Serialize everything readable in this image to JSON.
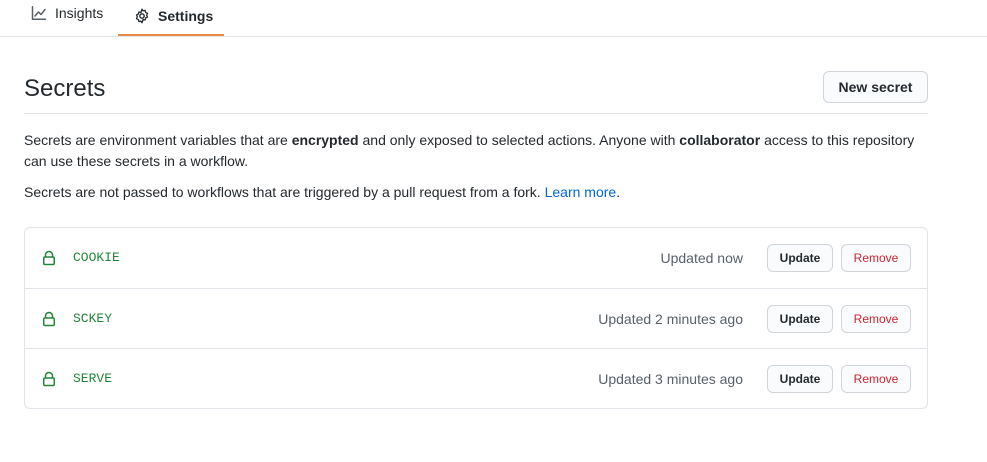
{
  "tabs": [
    {
      "label": "Insights",
      "icon": "graph-icon"
    },
    {
      "label": "Settings",
      "icon": "gear-icon"
    }
  ],
  "header": {
    "title": "Secrets",
    "new_secret_label": "New secret"
  },
  "description": {
    "p1_a": "Secrets are environment variables that are ",
    "p1_b": "encrypted",
    "p1_c": " and only exposed to selected actions. Anyone with ",
    "p1_d": "collaborator",
    "p1_e": " access to this repository can use these secrets in a workflow.",
    "p2_a": "Secrets are not passed to workflows that are triggered by a pull request from a fork. ",
    "p2_link": "Learn more",
    "p2_end": "."
  },
  "secrets": [
    {
      "name": "COOKIE",
      "updated": "Updated now",
      "update_label": "Update",
      "remove_label": "Remove"
    },
    {
      "name": "SCKEY",
      "updated": "Updated 2 minutes ago",
      "update_label": "Update",
      "remove_label": "Remove"
    },
    {
      "name": "SERVE",
      "updated": "Updated 3 minutes ago",
      "update_label": "Update",
      "remove_label": "Remove"
    }
  ],
  "colors": {
    "accent_underline": "#e36209",
    "secret_name": "#22863a",
    "remove_text": "#cb2431",
    "link": "#0366d6"
  }
}
